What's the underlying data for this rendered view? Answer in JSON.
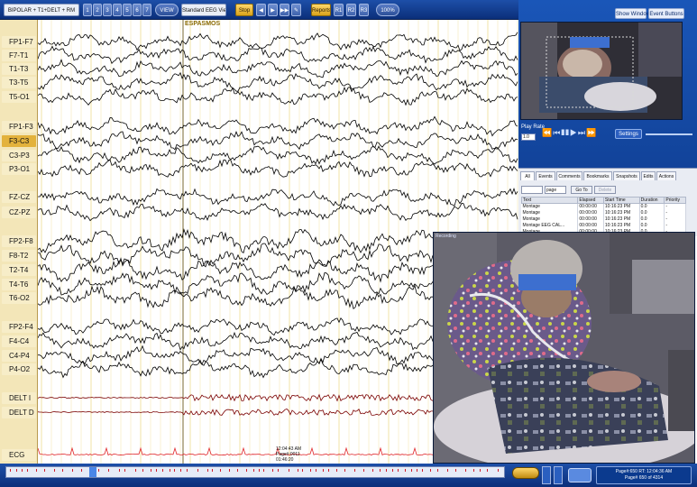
{
  "toolbar": {
    "montage_select": "BIPOLAR + T1+DELT + RM",
    "grid_buttons": [
      "1",
      "2",
      "3",
      "4",
      "5",
      "6",
      "7"
    ],
    "view_label": "VIEW",
    "view_select": "Standard EEG View",
    "stop_label": "Stop",
    "playback_icons": [
      "rewind-icon",
      "play-icon",
      "forward-icon",
      "marker-icon"
    ],
    "reports_label": "Reports",
    "r_buttons": [
      "R1",
      "R2",
      "R3"
    ],
    "zoom_label": "100%",
    "show_window_label": "Show Window",
    "event_buttons_label": "Event Buttons"
  },
  "eeg": {
    "event_label": "ESPASMOS",
    "channels": [
      {
        "label": "FP1-F7",
        "selected": false
      },
      {
        "label": "F7-T1",
        "selected": false
      },
      {
        "label": "T1-T3",
        "selected": false
      },
      {
        "label": "T3-T5",
        "selected": false
      },
      {
        "label": "T5-O1",
        "selected": false
      },
      {
        "label": "FP1-F3",
        "selected": false
      },
      {
        "label": "F3-C3",
        "selected": true
      },
      {
        "label": "C3-P3",
        "selected": false
      },
      {
        "label": "P3-O1",
        "selected": false
      },
      {
        "label": "FZ-CZ",
        "selected": false
      },
      {
        "label": "CZ-PZ",
        "selected": false
      },
      {
        "label": "FP2-F8",
        "selected": false
      },
      {
        "label": "F8-T2",
        "selected": false
      },
      {
        "label": "T2-T4",
        "selected": false
      },
      {
        "label": "T4-T6",
        "selected": false
      },
      {
        "label": "T6-O2",
        "selected": false
      },
      {
        "label": "FP2-F4",
        "selected": false
      },
      {
        "label": "F4-C4",
        "selected": false
      },
      {
        "label": "C4-P4",
        "selected": false
      },
      {
        "label": "P4-O2",
        "selected": false
      },
      {
        "label": "DELT I",
        "selected": false
      },
      {
        "label": "DELT D",
        "selected": false
      },
      {
        "label": "ECG",
        "selected": false
      }
    ],
    "timestamp_lines": [
      "12:04:43 AM",
      "Page#:0011",
      "01:46:20"
    ],
    "trace_color": "#000000",
    "emg_color": "#7a0000",
    "ecg_color": "#e0262a",
    "grid_color": "#f1e3a6"
  },
  "video_panel": {
    "show_window": "Show Window",
    "event_buttons": "Event Buttons",
    "play_rate_label": "Play Rate",
    "play_rate_value": "1.0",
    "settings_label": "Settings",
    "control_icons": [
      "rewind-icon",
      "step-back-icon",
      "pause-icon",
      "play-icon",
      "step-forward-icon",
      "fast-forward-icon"
    ]
  },
  "events_panel": {
    "tabs": [
      "All",
      "Events",
      "Comments",
      "Bookmarks",
      "Snapshots",
      "Edits",
      "Actions"
    ],
    "active_tab": "All",
    "page_value": "",
    "page_unit": "page",
    "goto_label": "Go To",
    "delete_label": "Delete",
    "columns": [
      "Text",
      "Elapsed",
      "Start Time",
      "Duration",
      "Priority"
    ],
    "rows": [
      [
        "Montage",
        "00:00:00",
        "10:16:23 PM",
        "0.0",
        "-"
      ],
      [
        "Montage",
        "00:00:00",
        "10:16:23 PM",
        "0.0",
        "-"
      ],
      [
        "Montage",
        "00:00:00",
        "10:16:23 PM",
        "0.0",
        "-"
      ],
      [
        "Montage EEG CAL...",
        "00:00:00",
        "10:16:23 PM",
        "0.0",
        "-"
      ],
      [
        "Montage",
        "00:00:00",
        "10:16:23 PM",
        "0.0",
        "-"
      ]
    ]
  },
  "large_video": {
    "label": "Recording"
  },
  "bottom_bar": {
    "page_info_1": "Page#:650  RT: 12:04:36 AM",
    "page_info_2": "Page# 650 of 4314"
  }
}
